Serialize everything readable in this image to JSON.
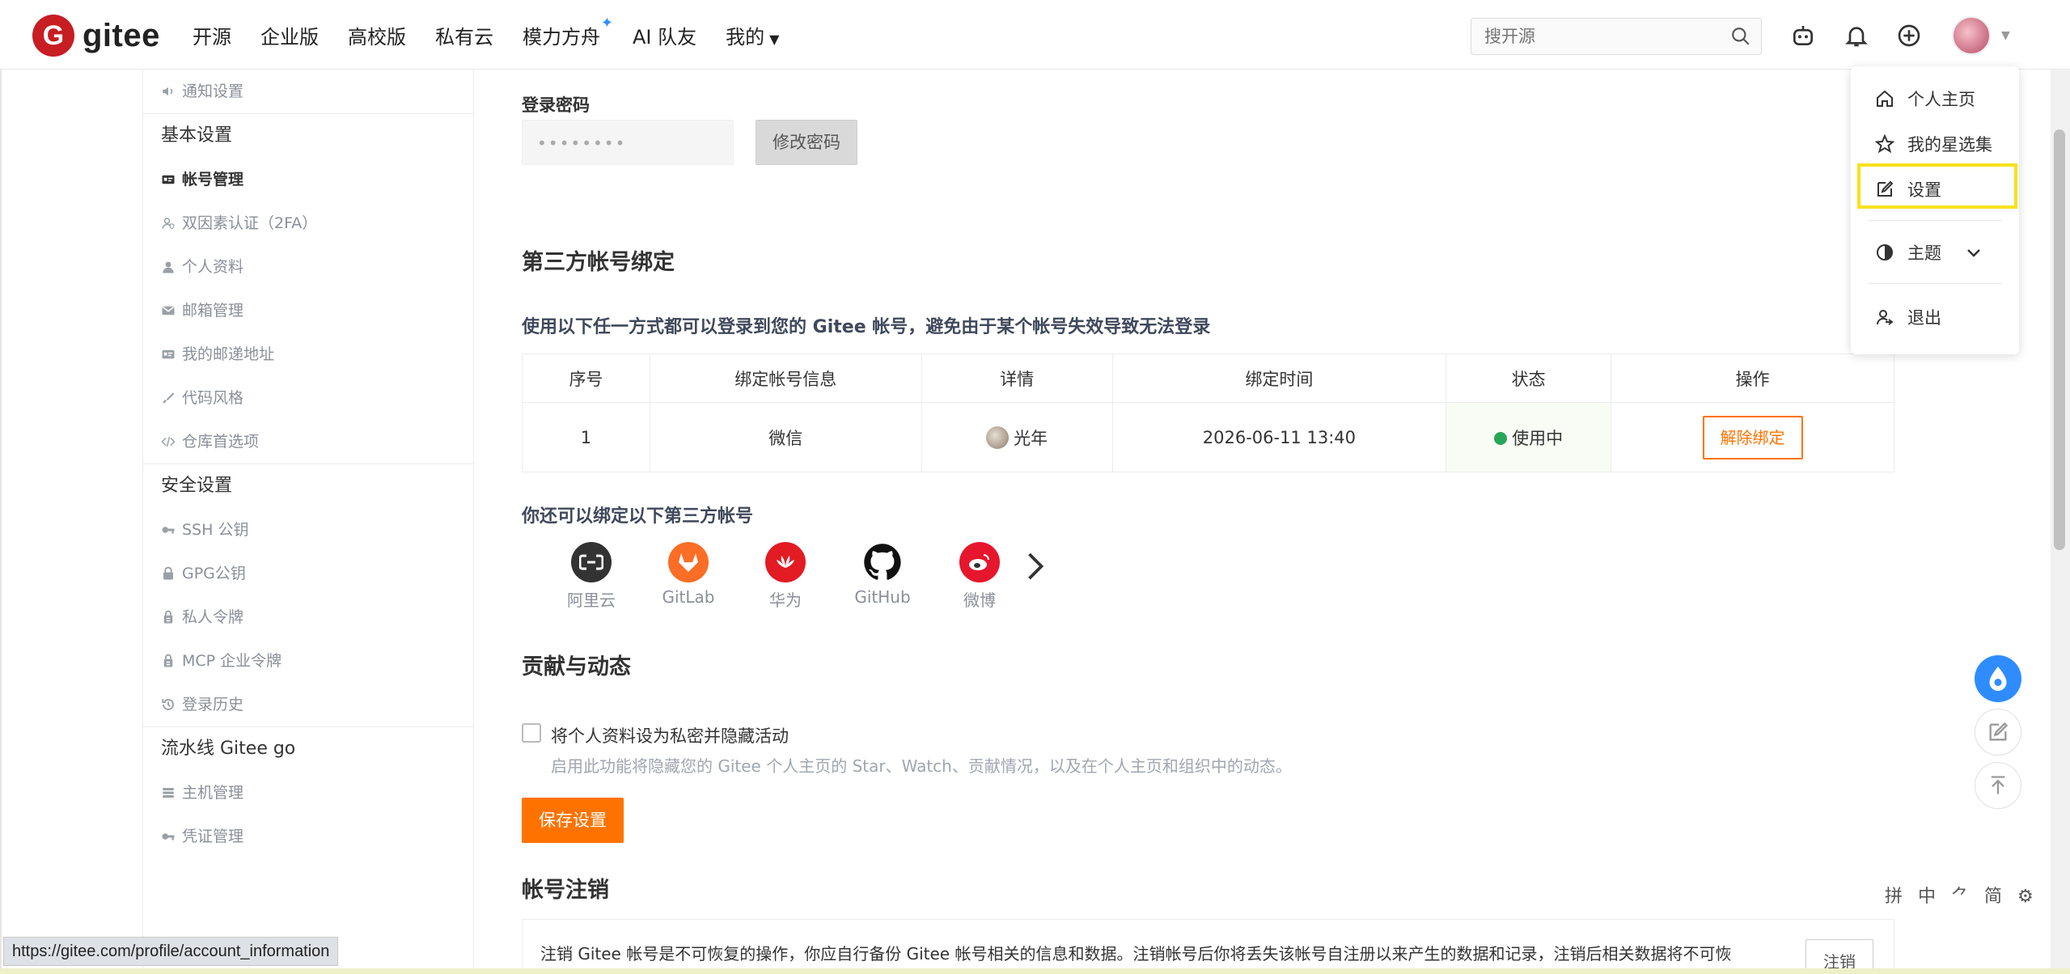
{
  "nav": {
    "logo_text": "gitee",
    "logo_letter": "G",
    "items": [
      "开源",
      "企业版",
      "高校版",
      "私有云",
      "模力方舟",
      "AI 队友",
      "我的"
    ],
    "search_placeholder": "搜开源"
  },
  "sidebar": {
    "top_item": "通知设置",
    "groups": [
      {
        "title": "基本设置",
        "items": [
          "帐号管理",
          "双因素认证（2FA）",
          "个人资料",
          "邮箱管理",
          "我的邮递地址",
          "代码风格",
          "仓库首选项"
        ]
      },
      {
        "title": "安全设置",
        "items": [
          "SSH 公钥",
          "GPG公钥",
          "私人令牌",
          "MCP 企业令牌",
          "登录历史"
        ]
      },
      {
        "title": "流水线 Gitee go",
        "items": [
          "主机管理",
          "凭证管理"
        ]
      }
    ]
  },
  "main": {
    "password_label": "登录密码",
    "password_mask": "••••••••",
    "change_password": "修改密码",
    "third_party_title": "第三方帐号绑定",
    "third_party_desc": "使用以下任一方式都可以登录到您的 Gitee 帐号，避免由于某个帐号失效导致无法登录",
    "table": {
      "headers": [
        "序号",
        "绑定帐号信息",
        "详情",
        "绑定时间",
        "状态",
        "操作"
      ],
      "rows": [
        {
          "index": "1",
          "account": "微信",
          "detail": "光年",
          "time": "2026-06-11 13:40",
          "status": "使用中",
          "action": "解除绑定"
        }
      ]
    },
    "more_bind_title": "你还可以绑定以下第三方帐号",
    "providers": [
      {
        "name": "阿里云",
        "color": "#333333"
      },
      {
        "name": "GitLab",
        "color": "#fc6d26"
      },
      {
        "name": "华为",
        "color": "#e31b23"
      },
      {
        "name": "GitHub",
        "color": "#111111"
      },
      {
        "name": "微博",
        "color": "#e6162d"
      }
    ],
    "contrib_title": "贡献与动态",
    "private_label": "将个人资料设为私密并隐藏活动",
    "private_desc": "启用此功能将隐藏您的 Gitee 个人主页的 Star、Watch、贡献情况，以及在个人主页和组织中的动态。",
    "save_button": "保存设置",
    "cancel_title": "帐号注销",
    "cancel_desc": "注销 Gitee 帐号是不可恢复的操作，你应自行备份 Gitee 帐号相关的信息和数据。注销帐号后你将丢失该帐号自注册以来产生的数据和记录，注销后相关数据将不可恢",
    "cancel_button": "注销"
  },
  "dropdown": {
    "items": [
      "个人主页",
      "我的星选集",
      "设置",
      "主题",
      "退出"
    ]
  },
  "status_url": "https://gitee.com/profile/account_information",
  "ime_text": "拼 中 ⺈ 简 ⚙",
  "colors": {
    "brand": "#c71d23",
    "accent": "#fe7300",
    "status_ok": "#27a65a",
    "highlight": "#f7e11c"
  }
}
